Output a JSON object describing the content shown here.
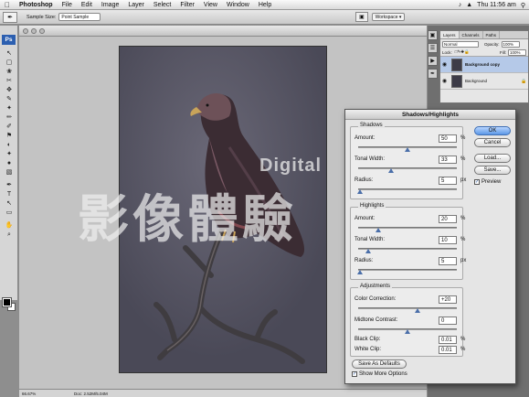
{
  "menubar": {
    "apple_icon": "apple-icon",
    "items": [
      "Photoshop",
      "File",
      "Edit",
      "Image",
      "Layer",
      "Select",
      "Filter",
      "View",
      "Window",
      "Help"
    ],
    "clock": "Thu 11:56 am"
  },
  "options_bar": {
    "sample_size_label": "Sample Size:",
    "sample_size_value": "Point Sample",
    "workspace_label": "Workspace ▾"
  },
  "tools": {
    "logo": "Ps",
    "icons": [
      "↖",
      "▢",
      "❀",
      "✂",
      "✥",
      "✎",
      "✦",
      "✏",
      "✐",
      "⚑",
      "◐",
      "✦",
      "●",
      "▧",
      "✒",
      "T",
      "↖",
      "▭",
      "✋",
      "⌕"
    ]
  },
  "document": {
    "zoom": "66.67%",
    "doc_size": "Doc: 2.52M/5.04M",
    "watermark_latin": "Digital",
    "watermark_cjk": "影像體驗"
  },
  "layers_panel": {
    "tabs": [
      "Layers",
      "Channels",
      "Paths"
    ],
    "blend_mode": "Normal",
    "opacity_label": "Opacity:",
    "opacity_value": "100%",
    "lock_label": "Lock:",
    "fill_label": "Fill:",
    "fill_value": "100%",
    "layers": [
      {
        "name": "Background copy",
        "selected": true
      },
      {
        "name": "Background",
        "selected": false
      }
    ]
  },
  "dialog": {
    "title": "Shadows/Highlights",
    "shadows": {
      "title": "Shadows",
      "amount_label": "Amount:",
      "amount_value": "50",
      "amount_unit": "%",
      "amount_level": 0.5,
      "tonal_label": "Tonal Width:",
      "tonal_value": "33",
      "tonal_unit": "%",
      "tonal_level": 0.33,
      "radius_label": "Radius:",
      "radius_value": "5",
      "radius_unit": "px",
      "radius_level": 0.02
    },
    "highlights": {
      "title": "Highlights",
      "amount_label": "Amount:",
      "amount_value": "20",
      "amount_unit": "%",
      "amount_level": 0.2,
      "tonal_label": "Tonal Width:",
      "tonal_value": "10",
      "tonal_unit": "%",
      "tonal_level": 0.1,
      "radius_label": "Radius:",
      "radius_value": "5",
      "radius_unit": "px",
      "radius_level": 0.02
    },
    "adjustments": {
      "title": "Adjustments",
      "color_label": "Color Correction:",
      "color_value": "+20",
      "color_level": 0.6,
      "midtone_label": "Midtone Contrast:",
      "midtone_value": "0",
      "midtone_level": 0.5,
      "black_label": "Black Clip:",
      "black_value": "0.01",
      "black_unit": "%",
      "white_label": "White Clip:",
      "white_value": "0.01",
      "white_unit": "%"
    },
    "buttons": {
      "ok": "OK",
      "cancel": "Cancel",
      "load": "Load...",
      "save": "Save...",
      "preview": "Preview",
      "save_defaults": "Save As Defaults",
      "show_more": "Show More Options"
    }
  }
}
